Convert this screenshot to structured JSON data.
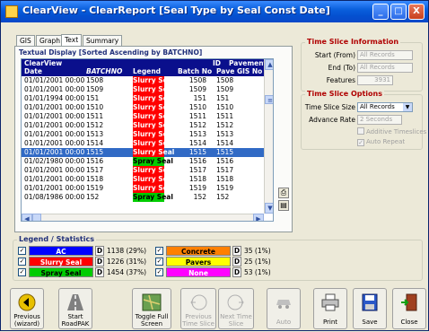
{
  "window": {
    "title": "ClearView - ClearReport [Seal Type by Seal Const Date]",
    "controls": [
      "_",
      "□",
      "X"
    ]
  },
  "tabs": [
    {
      "label": "GIS"
    },
    {
      "label": "Graph"
    },
    {
      "label": "Text"
    },
    {
      "label": "Summary"
    }
  ],
  "panel": {
    "title": "Textual Display [Sorted Ascending by BATCHNO]"
  },
  "grid": {
    "headers": {
      "h1a": "ClearView",
      "h1b": "ID",
      "h1c": "Pavement",
      "date": "Date",
      "batchno": "BATCHNO",
      "legend": "Legend",
      "batch_no": "Batch No",
      "pave_gis_no": "Pave GIS No"
    },
    "rows": [
      {
        "date": "01/01/2001 00:00",
        "batch": "1508",
        "legend": "Slurry Seal",
        "color": "#ff0000",
        "batch_no": "1508",
        "gis": "1508"
      },
      {
        "date": "01/01/2001 00:00",
        "batch": "1509",
        "legend": "Slurry Seal",
        "color": "#ff0000",
        "batch_no": "1509",
        "gis": "1509"
      },
      {
        "date": "01/01/1994 00:00",
        "batch": "151",
        "legend": "Slurry Seal",
        "color": "#ff0000",
        "batch_no": "151",
        "gis": "151"
      },
      {
        "date": "01/01/2001 00:00",
        "batch": "1510",
        "legend": "Slurry Seal",
        "color": "#ff0000",
        "batch_no": "1510",
        "gis": "1510"
      },
      {
        "date": "01/01/2001 00:00",
        "batch": "1511",
        "legend": "Slurry Seal",
        "color": "#ff0000",
        "batch_no": "1511",
        "gis": "1511"
      },
      {
        "date": "01/01/2001 00:00",
        "batch": "1512",
        "legend": "Slurry Seal",
        "color": "#ff0000",
        "batch_no": "1512",
        "gis": "1512"
      },
      {
        "date": "01/01/2001 00:00",
        "batch": "1513",
        "legend": "Slurry Seal",
        "color": "#ff0000",
        "batch_no": "1513",
        "gis": "1513"
      },
      {
        "date": "01/01/2001 00:00",
        "batch": "1514",
        "legend": "Slurry Seal",
        "color": "#ff0000",
        "batch_no": "1514",
        "gis": "1514"
      },
      {
        "date": "01/01/2001 00:00",
        "batch": "1515",
        "legend": "Slurry Seal",
        "color": "#ff0000",
        "batch_no": "1515",
        "gis": "1515",
        "selected": true
      },
      {
        "date": "01/02/1980 00:00",
        "batch": "1516",
        "legend": "Spray Seal",
        "color": "#00cc00",
        "batch_no": "1516",
        "gis": "1516"
      },
      {
        "date": "01/01/2001 00:00",
        "batch": "1517",
        "legend": "Slurry Seal",
        "color": "#ff0000",
        "batch_no": "1517",
        "gis": "1517"
      },
      {
        "date": "01/01/2001 00:00",
        "batch": "1518",
        "legend": "Slurry Seal",
        "color": "#ff0000",
        "batch_no": "1518",
        "gis": "1518"
      },
      {
        "date": "01/01/2001 00:00",
        "batch": "1519",
        "legend": "Slurry Seal",
        "color": "#ff0000",
        "batch_no": "1519",
        "gis": "1519"
      },
      {
        "date": "01/08/1986 00:00",
        "batch": "152",
        "legend": "Spray Seal",
        "color": "#00cc00",
        "batch_no": "152",
        "gis": "152"
      }
    ]
  },
  "time_slice_info": {
    "title": "Time Slice Information",
    "start_label": "Start (From)",
    "start_value": "All Records",
    "end_label": "End (To)",
    "end_value": "All Records",
    "features_label": "Features",
    "features_value": "3931"
  },
  "time_slice_options": {
    "title": "Time Slice Options",
    "size_label": "Time Slice Size",
    "size_value": "All Records",
    "rate_label": "Advance Rate",
    "rate_value": "2 Seconds",
    "additive_label": "Additive Timeslices",
    "autorepeat_label": "Auto Repeat"
  },
  "legend_stats": {
    "title": "Legend / Statistics",
    "items": [
      {
        "label": "AC",
        "bg": "#0000ff",
        "fg": "#ffffff",
        "stat": "1138 (29%)"
      },
      {
        "label": "Slurry Seal",
        "bg": "#ff0000",
        "fg": "#ffffff",
        "stat": "1226 (31%)"
      },
      {
        "label": "Spray Seal",
        "bg": "#00cc00",
        "fg": "#000000",
        "stat": "1454 (37%)"
      },
      {
        "label": "Concrete",
        "bg": "#ff8000",
        "fg": "#000000",
        "stat": "35 (1%)"
      },
      {
        "label": "Pavers",
        "bg": "#ffff00",
        "fg": "#000000",
        "stat": "25 (1%)"
      },
      {
        "label": "None",
        "bg": "#ff00ff",
        "fg": "#ffffff",
        "stat": "53 (1%)"
      }
    ],
    "d_label": "D"
  },
  "toolbar": {
    "previous": "Previous\n(wizard)",
    "start_roadpak": "Start\nRoadPAK",
    "toggle_full": "Toggle Full\nScreen",
    "prev_slice": "Previous\nTime Slice",
    "next_slice": "Next Time\nSlice",
    "auto": "Auto",
    "print": "Print",
    "save": "Save",
    "close": "Close"
  }
}
